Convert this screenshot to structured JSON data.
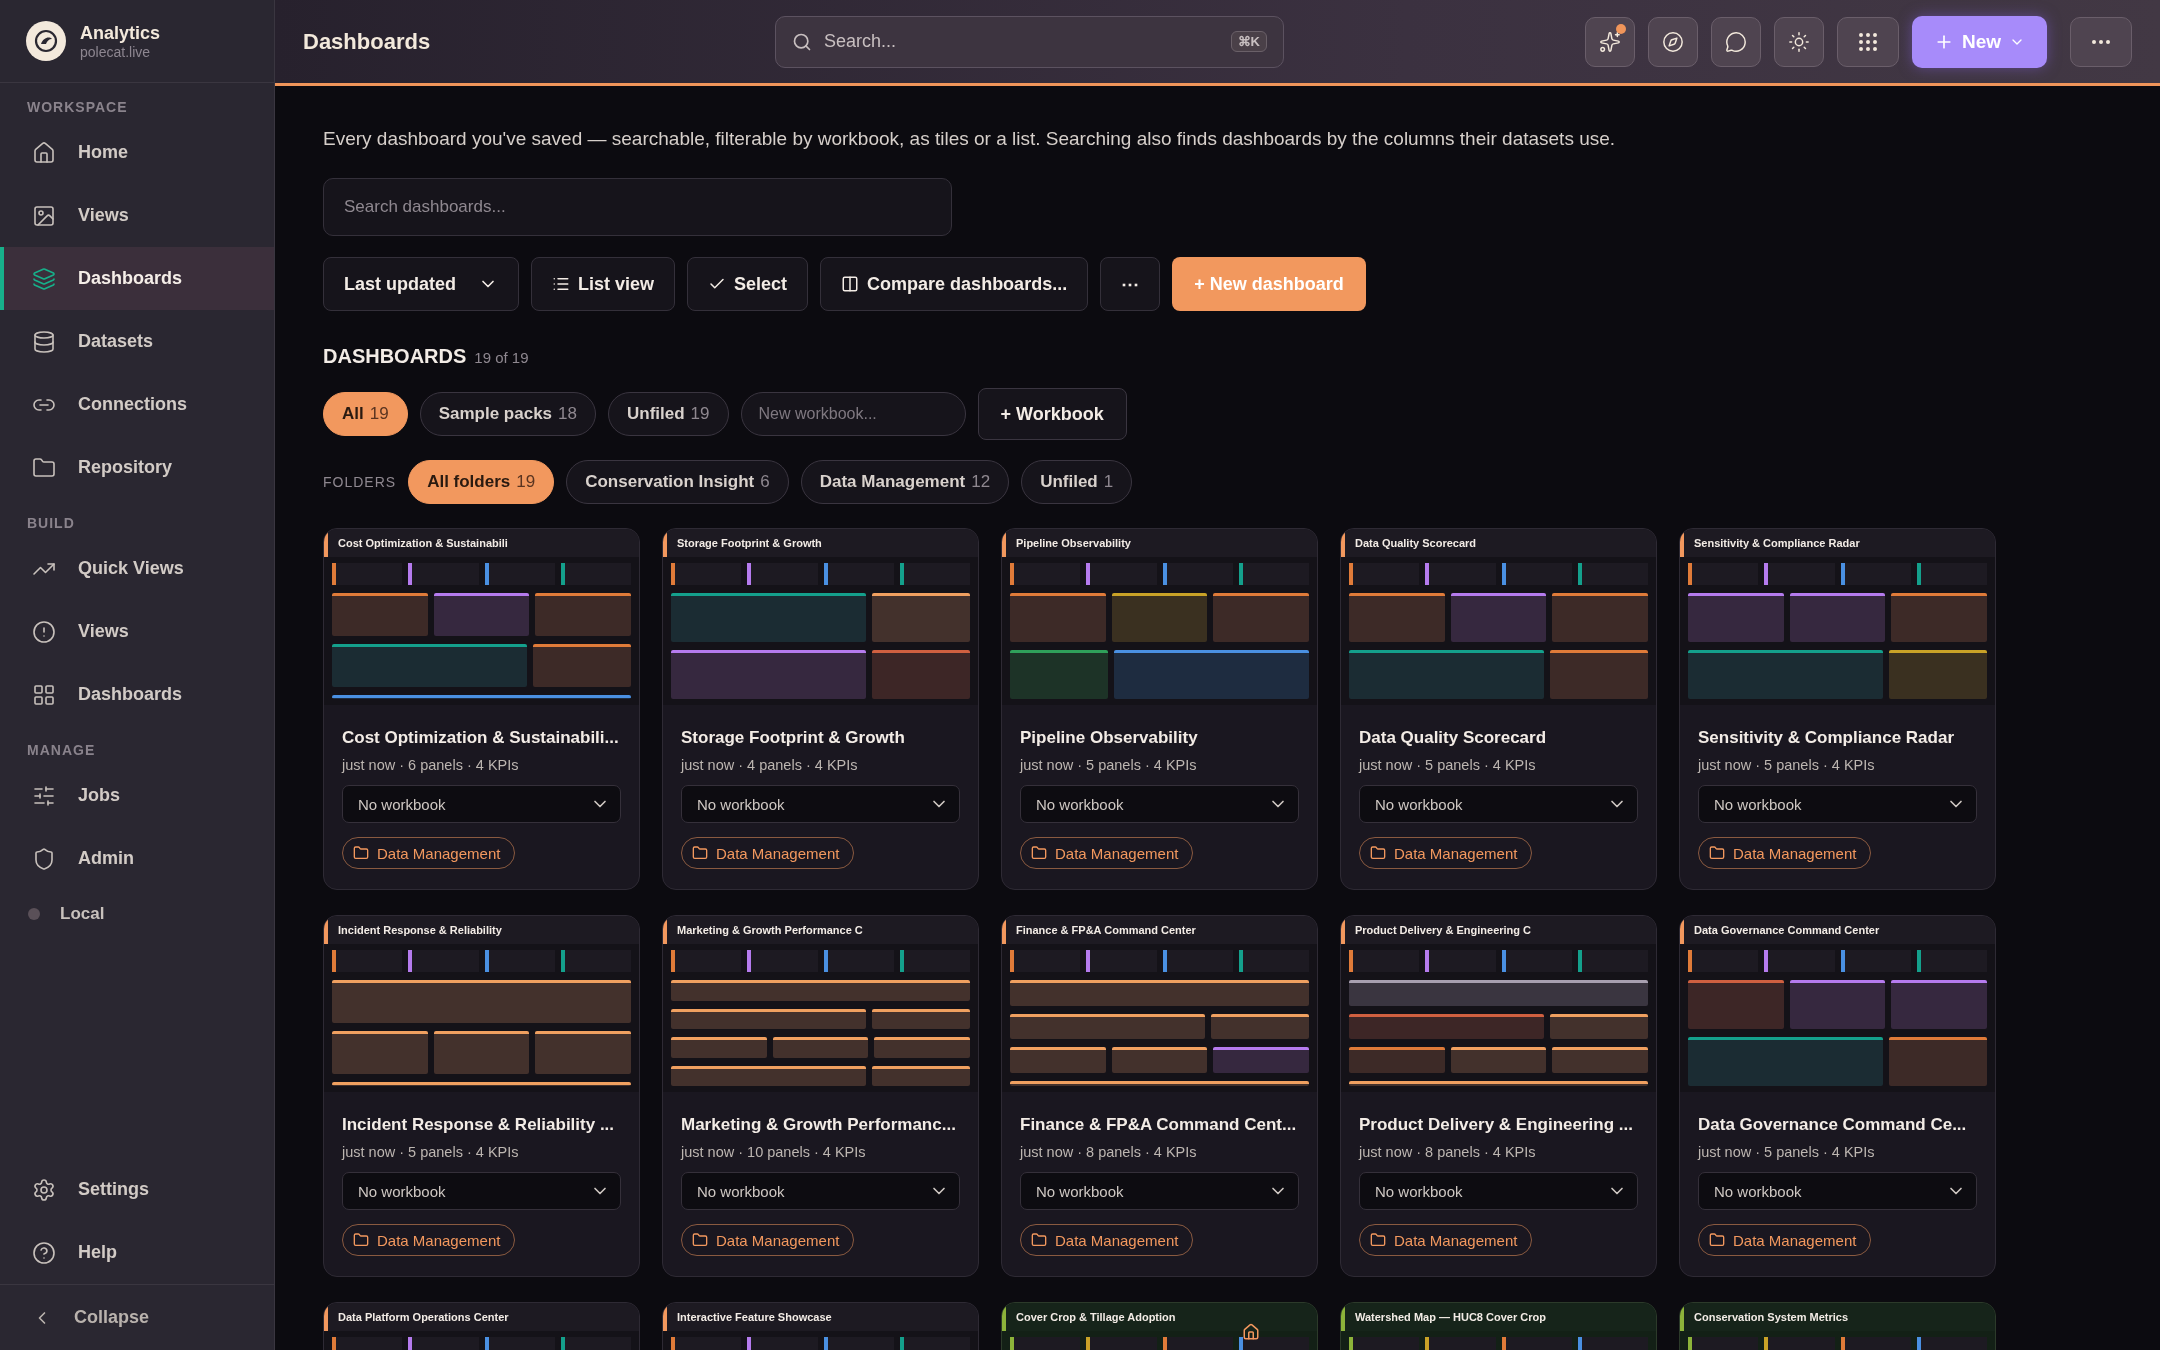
{
  "brand": {
    "name": "Analytics",
    "subtitle": "polecat.live"
  },
  "sidebar": {
    "sections": [
      {
        "heading": "WORKSPACE",
        "items": [
          {
            "label": "Home",
            "selected": false
          },
          {
            "label": "Views",
            "selected": false
          },
          {
            "label": "Dashboards",
            "selected": true
          },
          {
            "label": "Datasets",
            "selected": false
          },
          {
            "label": "Connections",
            "selected": false
          },
          {
            "label": "Repository",
            "selected": false
          }
        ]
      },
      {
        "heading": "BUILD",
        "items": [
          {
            "label": "Quick Views",
            "selected": false
          },
          {
            "label": "Views",
            "selected": false
          },
          {
            "label": "Dashboards",
            "selected": false
          }
        ]
      },
      {
        "heading": "MANAGE",
        "items": [
          {
            "label": "Jobs",
            "selected": false
          },
          {
            "label": "Admin",
            "selected": false
          }
        ]
      }
    ],
    "status": {
      "label": "Local",
      "color": "#5a5058"
    },
    "footer": [
      {
        "label": "Settings"
      },
      {
        "label": "Help"
      }
    ],
    "collapse": "Collapse"
  },
  "header": {
    "title": "Dashboards",
    "search_placeholder": "Search...",
    "shortcut": "⌘K",
    "new_label": "New",
    "sparkle_badge": true
  },
  "description": "Every dashboard you've saved — searchable, filterable by workbook, as tiles or a list. Searching also finds dashboards by the columns their datasets use.",
  "search": {
    "placeholder": "Search dashboards..."
  },
  "toolbar": {
    "sort": "Last updated",
    "buttons": [
      {
        "kind": "list",
        "label": "List view"
      },
      {
        "kind": "check",
        "label": "Select"
      },
      {
        "kind": "compare",
        "label": "Compare dashboards..."
      },
      {
        "kind": "more",
        "label": "⋯"
      }
    ],
    "primary": "+ New dashboard"
  },
  "section": {
    "title": "DASHBOARDS",
    "count": "19 of 19"
  },
  "workbook_chips": [
    {
      "label": "All",
      "count": "19",
      "selected": true
    },
    {
      "label": "Sample packs",
      "count": "18",
      "selected": false
    },
    {
      "label": "Unfiled",
      "count": "19",
      "selected": false
    }
  ],
  "new_workbook": {
    "placeholder": "New workbook...",
    "button": "+ Workbook"
  },
  "folders": {
    "label": "FOLDERS",
    "chips": [
      {
        "label": "All folders",
        "count": "19",
        "selected": true
      },
      {
        "label": "Conservation Insight",
        "count": "6",
        "selected": false
      },
      {
        "label": "Data Management",
        "count": "12",
        "selected": false
      },
      {
        "label": "Unfiled",
        "count": "1",
        "selected": false
      }
    ]
  },
  "cards": [
    {
      "strip": "Cost Optimization & Sustainabili",
      "kind": "dark",
      "title": "Cost Optimization & Sustainabili...",
      "meta": "just now · 6 panels · 4 KPIs",
      "workbook": "No workbook",
      "folder": "Data Management"
    },
    {
      "strip": "Storage Footprint & Growth",
      "kind": "dark",
      "title": "Storage Footprint & Growth",
      "meta": "just now · 4 panels · 4 KPIs",
      "workbook": "No workbook",
      "folder": "Data Management"
    },
    {
      "strip": "Pipeline Observability",
      "kind": "dark",
      "title": "Pipeline Observability",
      "meta": "just now · 5 panels · 4 KPIs",
      "workbook": "No workbook",
      "folder": "Data Management"
    },
    {
      "strip": "Data Quality Scorecard",
      "kind": "dark",
      "title": "Data Quality Scorecard",
      "meta": "just now · 5 panels · 4 KPIs",
      "workbook": "No workbook",
      "folder": "Data Management"
    },
    {
      "strip": "Sensitivity & Compliance Radar",
      "kind": "dark",
      "title": "Sensitivity & Compliance Radar",
      "meta": "just now · 5 panels · 4 KPIs",
      "workbook": "No workbook",
      "folder": "Data Management"
    },
    {
      "strip": "Incident Response & Reliability",
      "kind": "dark",
      "title": "Incident Response & Reliability ...",
      "meta": "just now · 5 panels · 4 KPIs",
      "workbook": "No workbook",
      "folder": "Data Management"
    },
    {
      "strip": "Marketing & Growth Performance C",
      "kind": "dark",
      "title": "Marketing & Growth Performanc...",
      "meta": "just now · 10 panels · 4 KPIs",
      "workbook": "No workbook",
      "folder": "Data Management"
    },
    {
      "strip": "Finance & FP&A Command Center",
      "kind": "dark",
      "title": "Finance & FP&A Command Cent...",
      "meta": "just now · 8 panels · 4 KPIs",
      "workbook": "No workbook",
      "folder": "Data Management"
    },
    {
      "strip": "Product Delivery & Engineering C",
      "kind": "dark",
      "title": "Product Delivery & Engineering ...",
      "meta": "just now · 8 panels · 4 KPIs",
      "workbook": "No workbook",
      "folder": "Data Management"
    },
    {
      "strip": "Data Governance Command Center",
      "kind": "dark",
      "title": "Data Governance Command Ce...",
      "meta": "just now · 5 panels · 4 KPIs",
      "workbook": "No workbook",
      "folder": "Data Management"
    },
    {
      "strip": "Data Platform Operations Center",
      "kind": "dark"
    },
    {
      "strip": "Interactive Feature Showcase",
      "kind": "dark"
    },
    {
      "strip": "Cover Crop & Tillage Adoption",
      "kind": "green",
      "home": true
    },
    {
      "strip": "Watershed Map — HUC8 Cover Crop",
      "kind": "green"
    },
    {
      "strip": "Conservation System Metrics",
      "kind": "green"
    }
  ]
}
